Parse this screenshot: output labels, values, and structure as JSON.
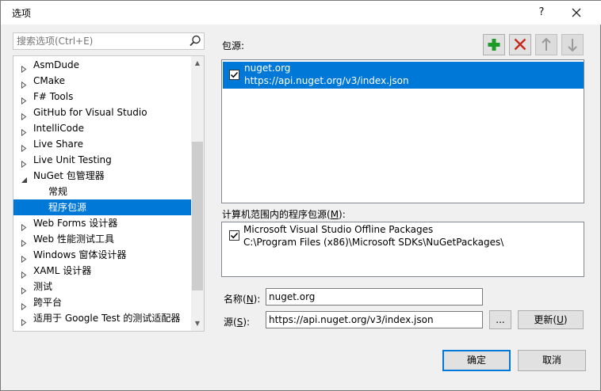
{
  "window": {
    "title": "选项",
    "help_label": "?",
    "close_label": "✕"
  },
  "search": {
    "placeholder": "搜索选项(Ctrl+E)"
  },
  "tree": {
    "items": [
      {
        "label": "AsmDude",
        "arrow": "collapsed"
      },
      {
        "label": "CMake",
        "arrow": "collapsed"
      },
      {
        "label": "F# Tools",
        "arrow": "collapsed"
      },
      {
        "label": "GitHub for Visual Studio",
        "arrow": "collapsed"
      },
      {
        "label": "IntelliCode",
        "arrow": "collapsed"
      },
      {
        "label": "Live Share",
        "arrow": "collapsed"
      },
      {
        "label": "Live Unit Testing",
        "arrow": "collapsed"
      },
      {
        "label": "NuGet 包管理器",
        "arrow": "expanded"
      },
      {
        "label": "常规",
        "arrow": "none"
      },
      {
        "label": "程序包源",
        "arrow": "none",
        "selected": true
      },
      {
        "label": "Web Forms 设计器",
        "arrow": "collapsed"
      },
      {
        "label": "Web 性能测试工具",
        "arrow": "collapsed"
      },
      {
        "label": "Windows 窗体设计器",
        "arrow": "collapsed"
      },
      {
        "label": "XAML 设计器",
        "arrow": "collapsed"
      },
      {
        "label": "测试",
        "arrow": "collapsed"
      },
      {
        "label": "跨平台",
        "arrow": "collapsed"
      },
      {
        "label": "适用于 Google Test 的测试适配器",
        "arrow": "collapsed"
      }
    ]
  },
  "sources": {
    "label": "包源:",
    "toolbar": {
      "add_icon": "plus-icon",
      "remove_icon": "x-icon",
      "up_icon": "arrow-up-icon",
      "down_icon": "arrow-down-icon"
    },
    "items": [
      {
        "name": "nuget.org",
        "url": "https://api.nuget.org/v3/index.json",
        "checked": true
      }
    ]
  },
  "machine_sources": {
    "label_prefix": "计算机范围内的程序包源(",
    "label_key": "M",
    "label_suffix": "):",
    "items": [
      {
        "name": "Microsoft Visual Studio Offline Packages",
        "path": "C:\\Program Files (x86)\\Microsoft SDKs\\NuGetPackages\\",
        "checked": true
      }
    ]
  },
  "form": {
    "name_label_prefix": "名称(",
    "name_label_key": "N",
    "name_label_suffix": "):",
    "name_value": "nuget.org",
    "source_label_prefix": "源(",
    "source_label_key": "S",
    "source_label_suffix": "):",
    "source_value": "https://api.nuget.org/v3/index.json",
    "browse_label": "...",
    "update_label_prefix": "更新(",
    "update_label_key": "U",
    "update_label_suffix": ")"
  },
  "footer": {
    "ok_label": "确定",
    "cancel_label": "取消"
  },
  "colors": {
    "accent": "#0078d7",
    "add_green": "#1e9a2a",
    "remove_red": "#c42b1c"
  }
}
